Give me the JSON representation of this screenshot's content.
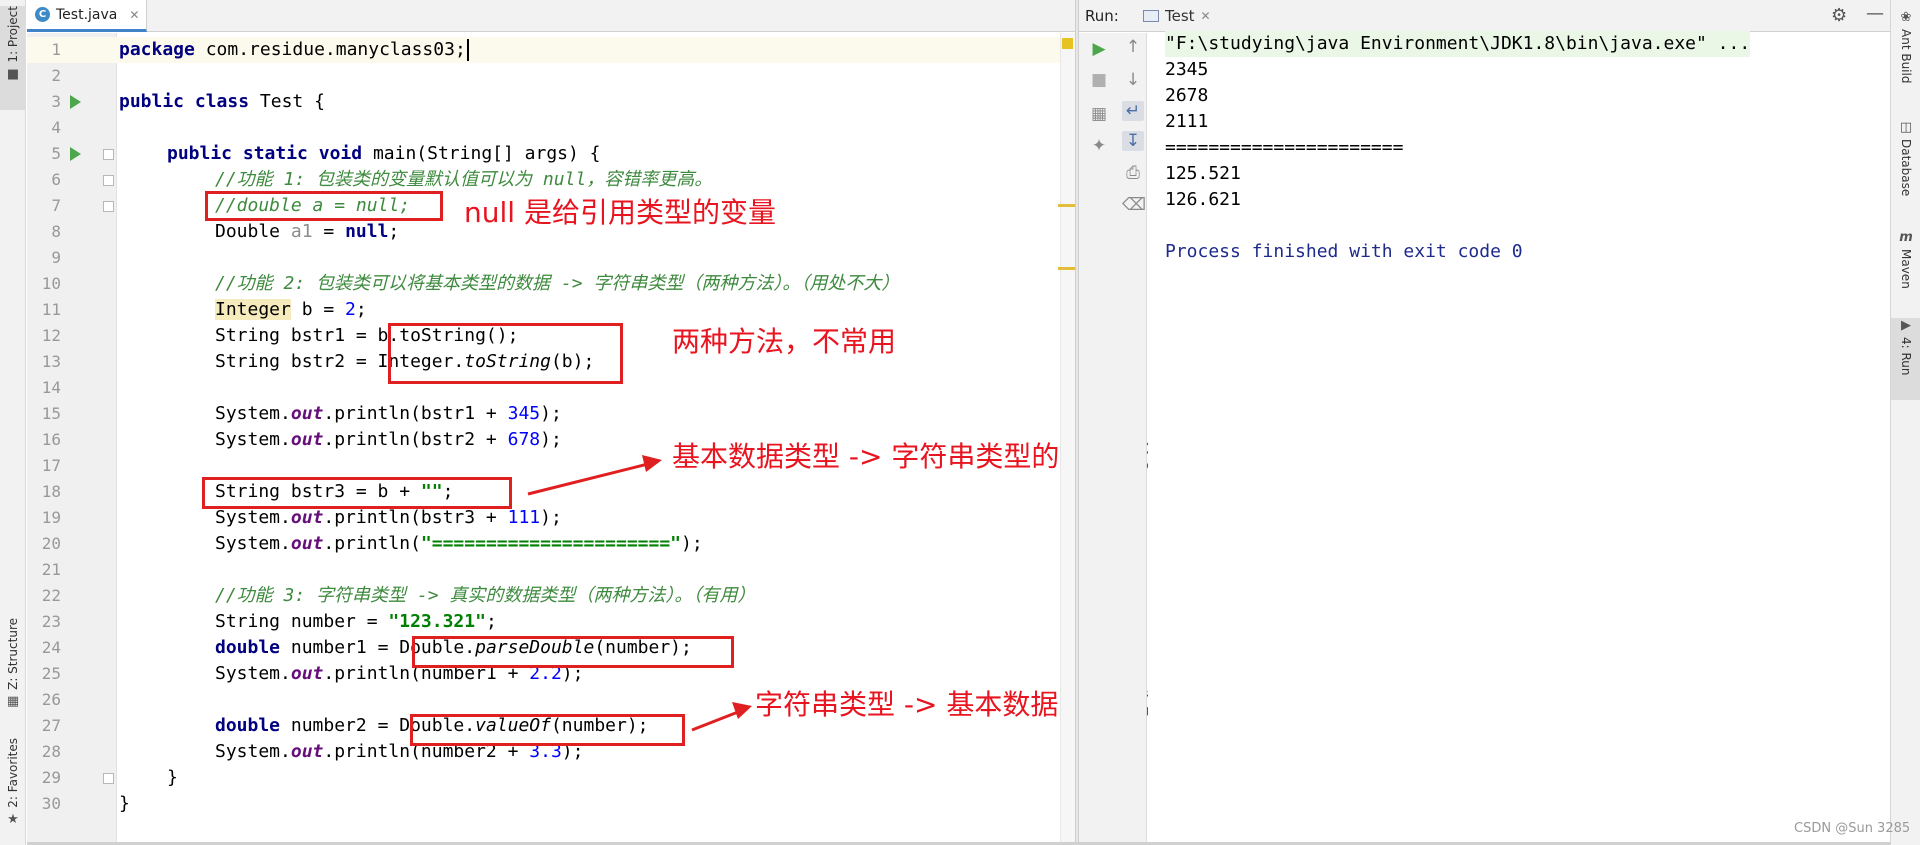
{
  "left_tabs": [
    {
      "label": "1: Project",
      "icon": "folder-icon"
    },
    {
      "label": "Z: Structure",
      "icon": "structure-icon"
    },
    {
      "label": "2: Favorites",
      "icon": "star-icon"
    }
  ],
  "editor": {
    "tab": {
      "name": "Test.java",
      "icon_letter": "C"
    },
    "line_numbers": [
      "1",
      "2",
      "3",
      "4",
      "5",
      "6",
      "7",
      "8",
      "9",
      "10",
      "11",
      "12",
      "13",
      "14",
      "15",
      "16",
      "17",
      "18",
      "19",
      "20",
      "21",
      "22",
      "23",
      "24",
      "25",
      "26",
      "27",
      "28",
      "29",
      "30"
    ],
    "code": {
      "l1_kw": "package",
      "l1_rest": " com.residue.manyclass03;",
      "l3_kw1": "public",
      "l3_kw2": "class",
      "l3_rest": " Test {",
      "l5_kw1": "public",
      "l5_kw2": "static",
      "l5_kw3": "void",
      "l5_rest": " main(String[] args) {",
      "l6_comment": "//功能 1: 包装类的变量默认值可以为 null，容错率更高。",
      "l7_comment": "//double a = null;",
      "l8_a": "Double ",
      "l8_var": "a1",
      "l8_b": " = ",
      "l8_kw": "null",
      "l8_c": ";",
      "l10_comment": "//功能 2: 包装类可以将基本类型的数据 -> 字符串类型（两种方法）。（用处不大）",
      "l11_type": "Integer",
      "l11_rest": " b = ",
      "l11_num": "2",
      "l11_end": ";",
      "l12_a": "String ",
      "l12_var": "bstr1",
      "l12_b": " = b.toString();",
      "l13_a": "String ",
      "l13_var": "bstr2",
      "l13_b": " = Integer.",
      "l13_met": "toString",
      "l13_c": "(b);",
      "l15_a": "System.",
      "l15_out": "out",
      "l15_b": ".println(bstr1 + ",
      "l15_num": "345",
      "l15_c": ");",
      "l16_a": "System.",
      "l16_out": "out",
      "l16_b": ".println(bstr2 + ",
      "l16_num": "678",
      "l16_c": ");",
      "l18_a": "String bstr3 = b + ",
      "l18_str": "\"\"",
      "l18_b": ";",
      "l19_a": "System.",
      "l19_out": "out",
      "l19_b": ".println(bstr3 + ",
      "l19_num": "111",
      "l19_c": ");",
      "l20_a": "System.",
      "l20_out": "out",
      "l20_b": ".println(",
      "l20_str": "\"======================\"",
      "l20_c": ");",
      "l22_comment": "//功能 3: 字符串类型 -> 真实的数据类型（两种方法）。（有用）",
      "l23_a": "String number = ",
      "l23_str": "\"123.321\"",
      "l23_b": ";",
      "l24_kw": "double",
      "l24_a": " number1 = Double.",
      "l24_met": "parseDouble",
      "l24_b": "(number);",
      "l25_a": "System.",
      "l25_out": "out",
      "l25_b": ".println(number1 + ",
      "l25_num": "2.2",
      "l25_c": ");",
      "l27_kw": "double",
      "l27_a": " number2 = Double.",
      "l27_met": "valueOf",
      "l27_b": "(number);",
      "l28_a": "System.",
      "l28_out": "out",
      "l28_b": ".println(number2 + ",
      "l28_num": "3.3",
      "l28_c": ");",
      "l29": "}",
      "l30": "}"
    }
  },
  "annotations": {
    "null_note": "null 是给引用类型的变量",
    "two_methods": "两种方法，不常用",
    "basic_to_string": "基本数据类型 -> 字符串类型的常用方法",
    "string_to_basic": "字符串类型 -> 基本数据类型的常用方法",
    "color": "#e8141f"
  },
  "run": {
    "label": "Run:",
    "tab": "Test",
    "console": [
      "\"F:\\studying\\java Environment\\JDK1.8\\bin\\java.exe\" ...",
      "2345",
      "2678",
      "2111",
      "======================",
      "125.521",
      "126.621",
      "",
      "Process finished with exit code 0"
    ]
  },
  "right_tabs": [
    {
      "label": "Ant Build",
      "icon": "ant-icon"
    },
    {
      "label": "Database",
      "icon": "database-icon"
    },
    {
      "label": "Maven",
      "icon": "maven-icon"
    },
    {
      "label": "4: Run",
      "icon": "run-icon"
    }
  ],
  "watermark": "CSDN @Sun 3285"
}
